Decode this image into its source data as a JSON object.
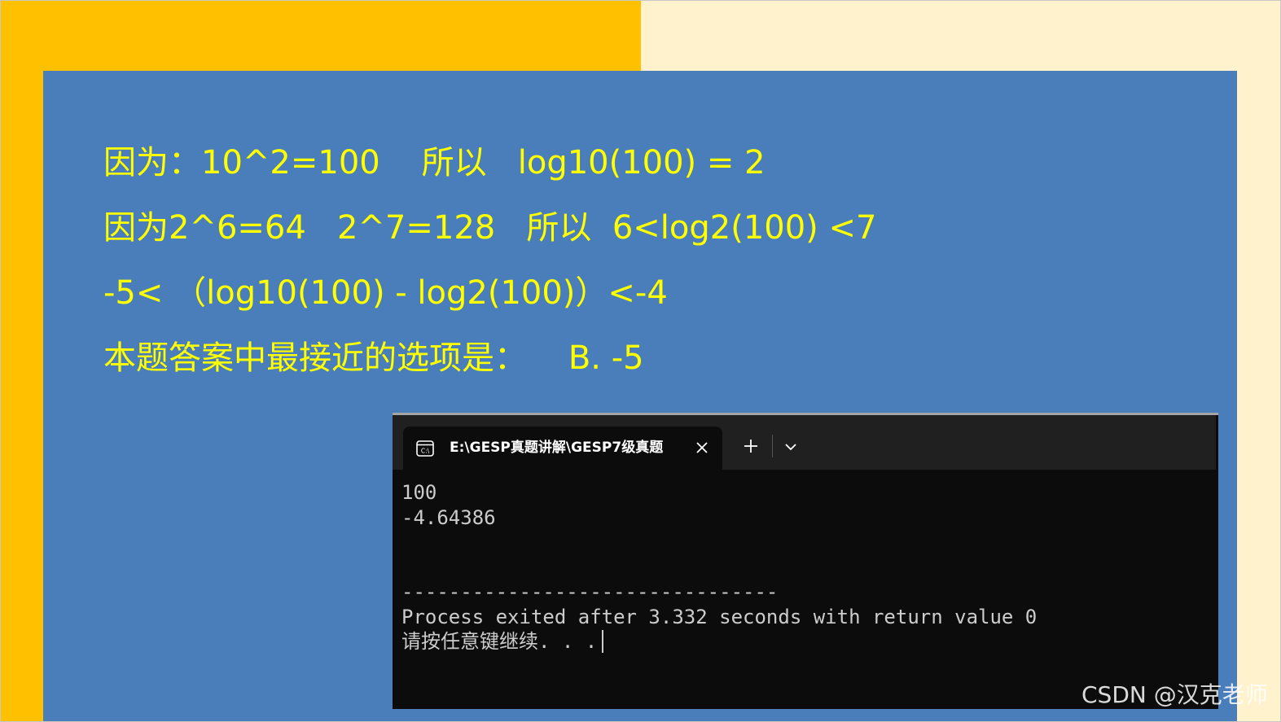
{
  "slide": {
    "colors": {
      "background": "#fff2cc",
      "orange_block": "#ffc000",
      "blue_panel": "#4a7ebb",
      "text": "#ffff00"
    },
    "lines": [
      "因为：10^2=100    所以   log10(100) = 2",
      "因为2^6=64   2^7=128   所以  6<log2(100) <7",
      "-5< （log10(100) - log2(100)）<-4",
      "本题答案中最接近的选项是：    B. -5"
    ]
  },
  "terminal": {
    "tab": {
      "icon": "terminal-icon",
      "title": "E:\\GESP真题讲解\\GESP7级真题",
      "close_icon": "close-icon"
    },
    "new_tab_icon": "plus-icon",
    "dropdown_icon": "chevron-down-icon",
    "output": [
      "100",
      "-4.64386",
      "",
      "",
      "--------------------------------",
      "Process exited after 3.332 seconds with return value 0",
      "请按任意键继续. . ."
    ],
    "colors": {
      "background": "#0c0c0c",
      "titlebar": "#202020",
      "text": "#cccccc"
    }
  },
  "watermark": {
    "text": "CSDN @汉克老师"
  }
}
